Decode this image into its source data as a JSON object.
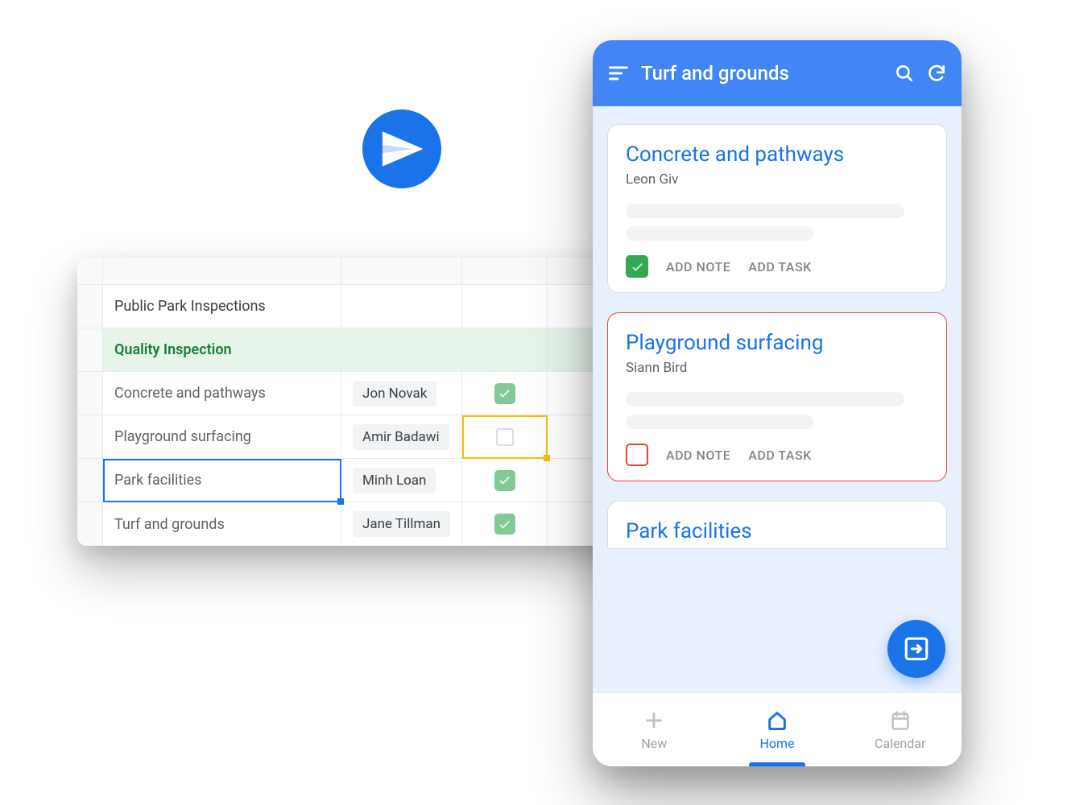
{
  "spreadsheet": {
    "title_row": "Public Park Inspections",
    "group_row": "Quality Inspection",
    "rows": [
      {
        "task": "Concrete and pathways",
        "person": "Jon Novak",
        "done": true
      },
      {
        "task": "Playground surfacing",
        "person": "Amir Badawi",
        "done": false
      },
      {
        "task": "Park facilities",
        "person": "Minh Loan",
        "done": true
      },
      {
        "task": "Turf and grounds",
        "person": "Jane Tillman",
        "done": true
      }
    ]
  },
  "phone": {
    "header_title": "Turf and grounds",
    "cards": [
      {
        "title": "Concrete and pathways",
        "subtitle": "Leon Giv",
        "done": true,
        "add_note": "ADD NOTE",
        "add_task": "ADD TASK"
      },
      {
        "title": "Playground surfacing",
        "subtitle": "Siann Bird",
        "done": false,
        "add_note": "ADD NOTE",
        "add_task": "ADD TASK"
      }
    ],
    "peek_title": "Park facilities",
    "nav": {
      "new": "New",
      "home": "Home",
      "calendar": "Calendar"
    }
  }
}
